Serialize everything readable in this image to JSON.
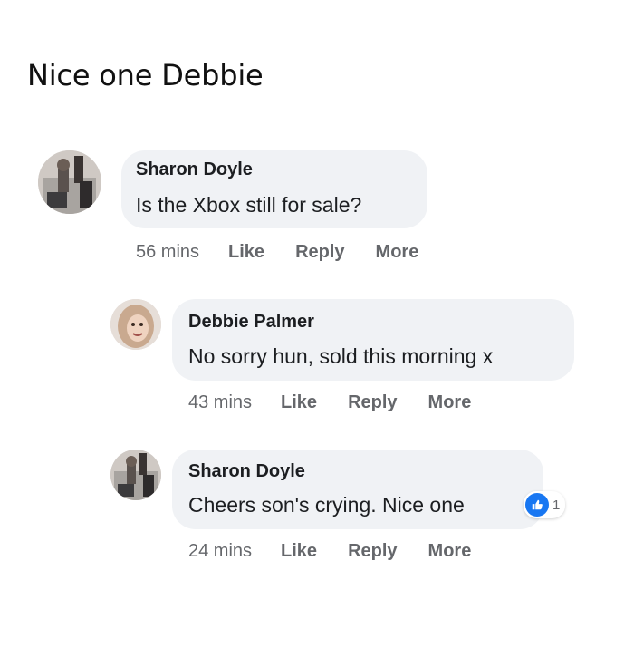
{
  "post": {
    "title": "Nice one Debbie"
  },
  "comments": [
    {
      "author": "Sharon Doyle",
      "text": "Is the Xbox still for sale?",
      "time": "56 mins",
      "like_label": "Like",
      "reply_label": "Reply",
      "more_label": "More"
    },
    {
      "author": "Debbie Palmer",
      "text": "No sorry hun, sold this morning x",
      "time": "43 mins",
      "like_label": "Like",
      "reply_label": "Reply",
      "more_label": "More"
    },
    {
      "author": "Sharon Doyle",
      "text": "Cheers son's crying. Nice one",
      "time": "24 mins",
      "like_label": "Like",
      "reply_label": "Reply",
      "more_label": "More",
      "reaction_count": "1"
    }
  ],
  "colors": {
    "bubble": "#f0f2f5",
    "meta_text": "#65676b",
    "like_blue": "#1877f2"
  },
  "icons": {
    "reaction": "thumbs-up-icon"
  }
}
